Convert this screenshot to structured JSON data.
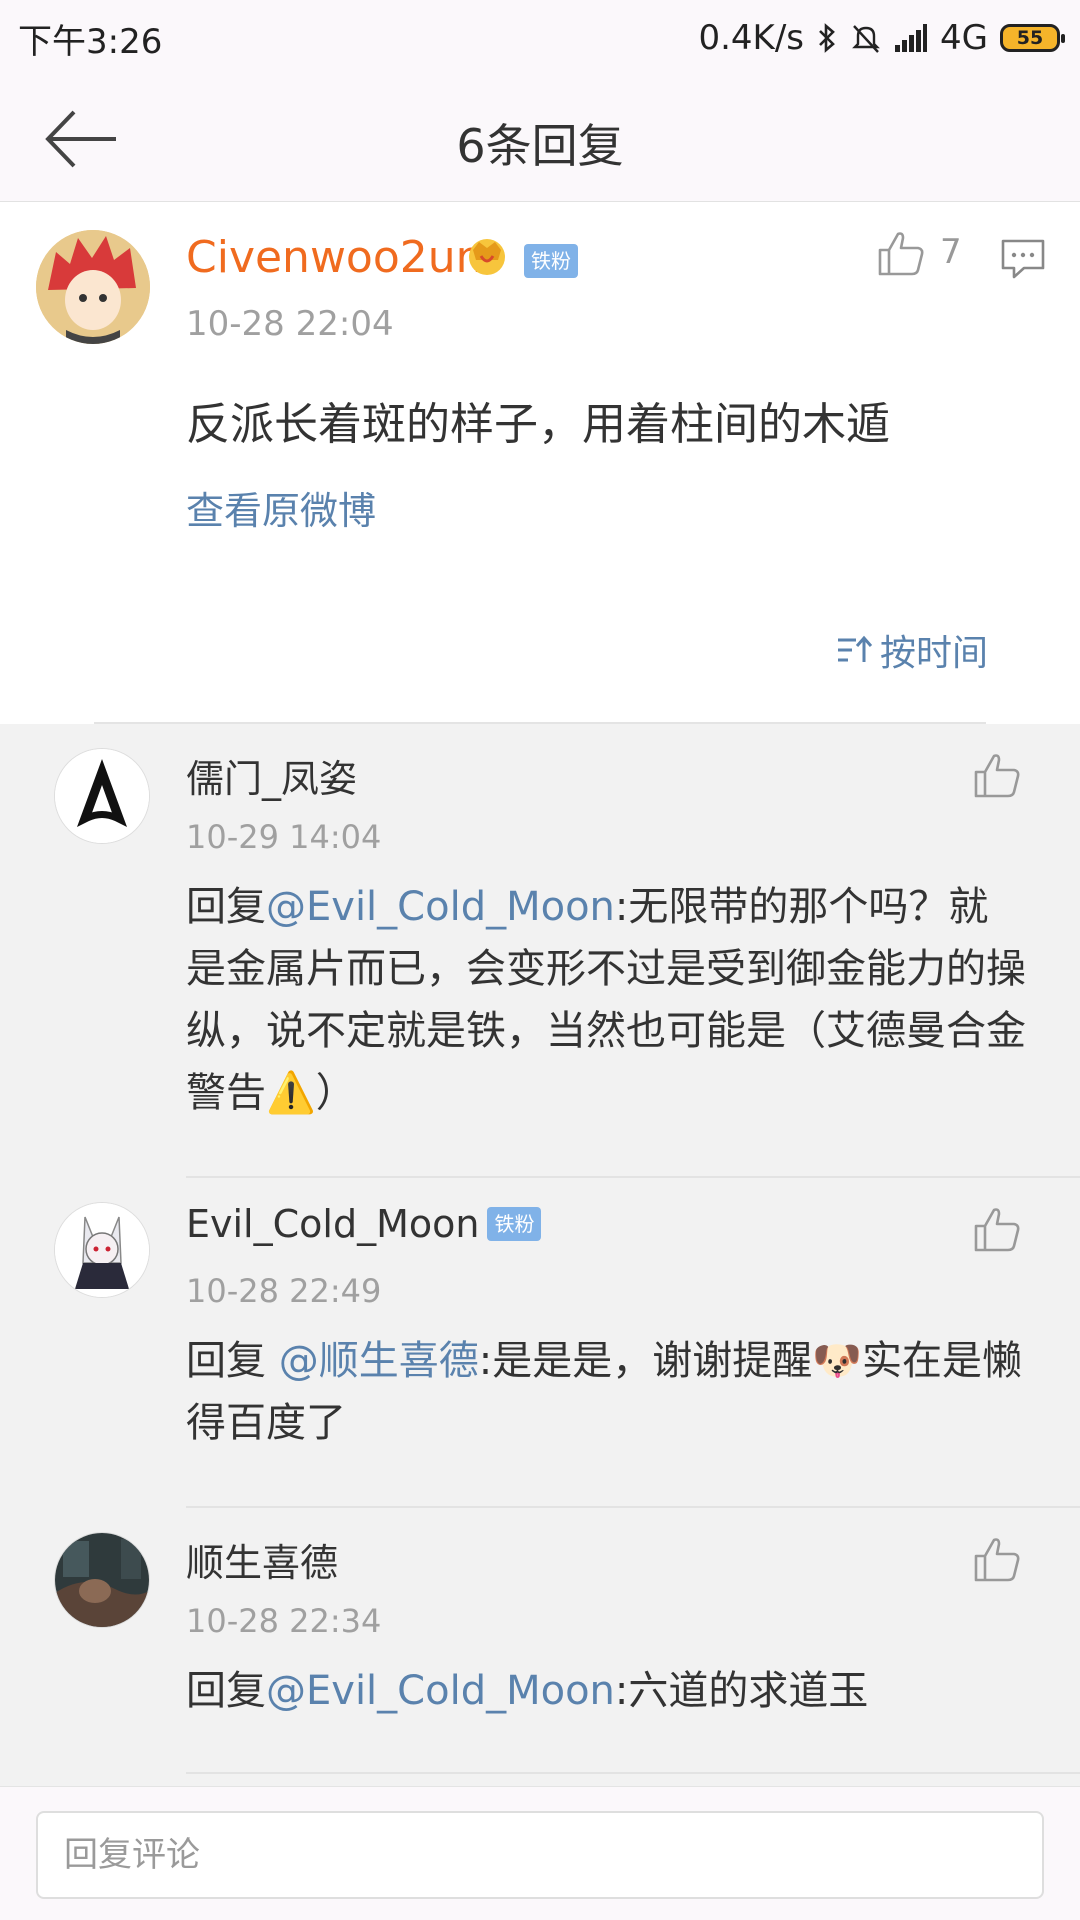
{
  "status_bar": {
    "time": "下午3:26",
    "net_speed": "0.4K/s",
    "network": "4G",
    "battery": "55"
  },
  "nav": {
    "title": "6条回复"
  },
  "main_comment": {
    "username": "Civenwoo2un",
    "fan_badge": "铁粉",
    "time": "10-28 22:04",
    "like_count": "7",
    "text": "反派长着斑的样子，用着柱间的木遁",
    "view_original": "查看原微博",
    "sort_label": "按时间"
  },
  "replies": [
    {
      "username": "儒门_凤姿",
      "time": "10-29 14:04",
      "prefix": "回复",
      "mention": "@Evil_Cold_Moon",
      "text": ":无限带的那个吗？就是金属片而已，会变形不过是受到御金能力的操纵，说不定就是铁，当然也可能是（艾德曼合金警告⚠️）"
    },
    {
      "username": "Evil_Cold_Moon",
      "fan_badge": "铁粉",
      "time": "10-28 22:49",
      "prefix": "回复 ",
      "mention": "@顺生喜德",
      "text": ":是是是，谢谢提醒🐶实在是懒得百度了"
    },
    {
      "username": "顺生喜德",
      "time": "10-28 22:34",
      "prefix": "回复",
      "mention": "@Evil_Cold_Moon",
      "text": ":六道的求道玉"
    }
  ],
  "input": {
    "placeholder": "回复评论"
  }
}
